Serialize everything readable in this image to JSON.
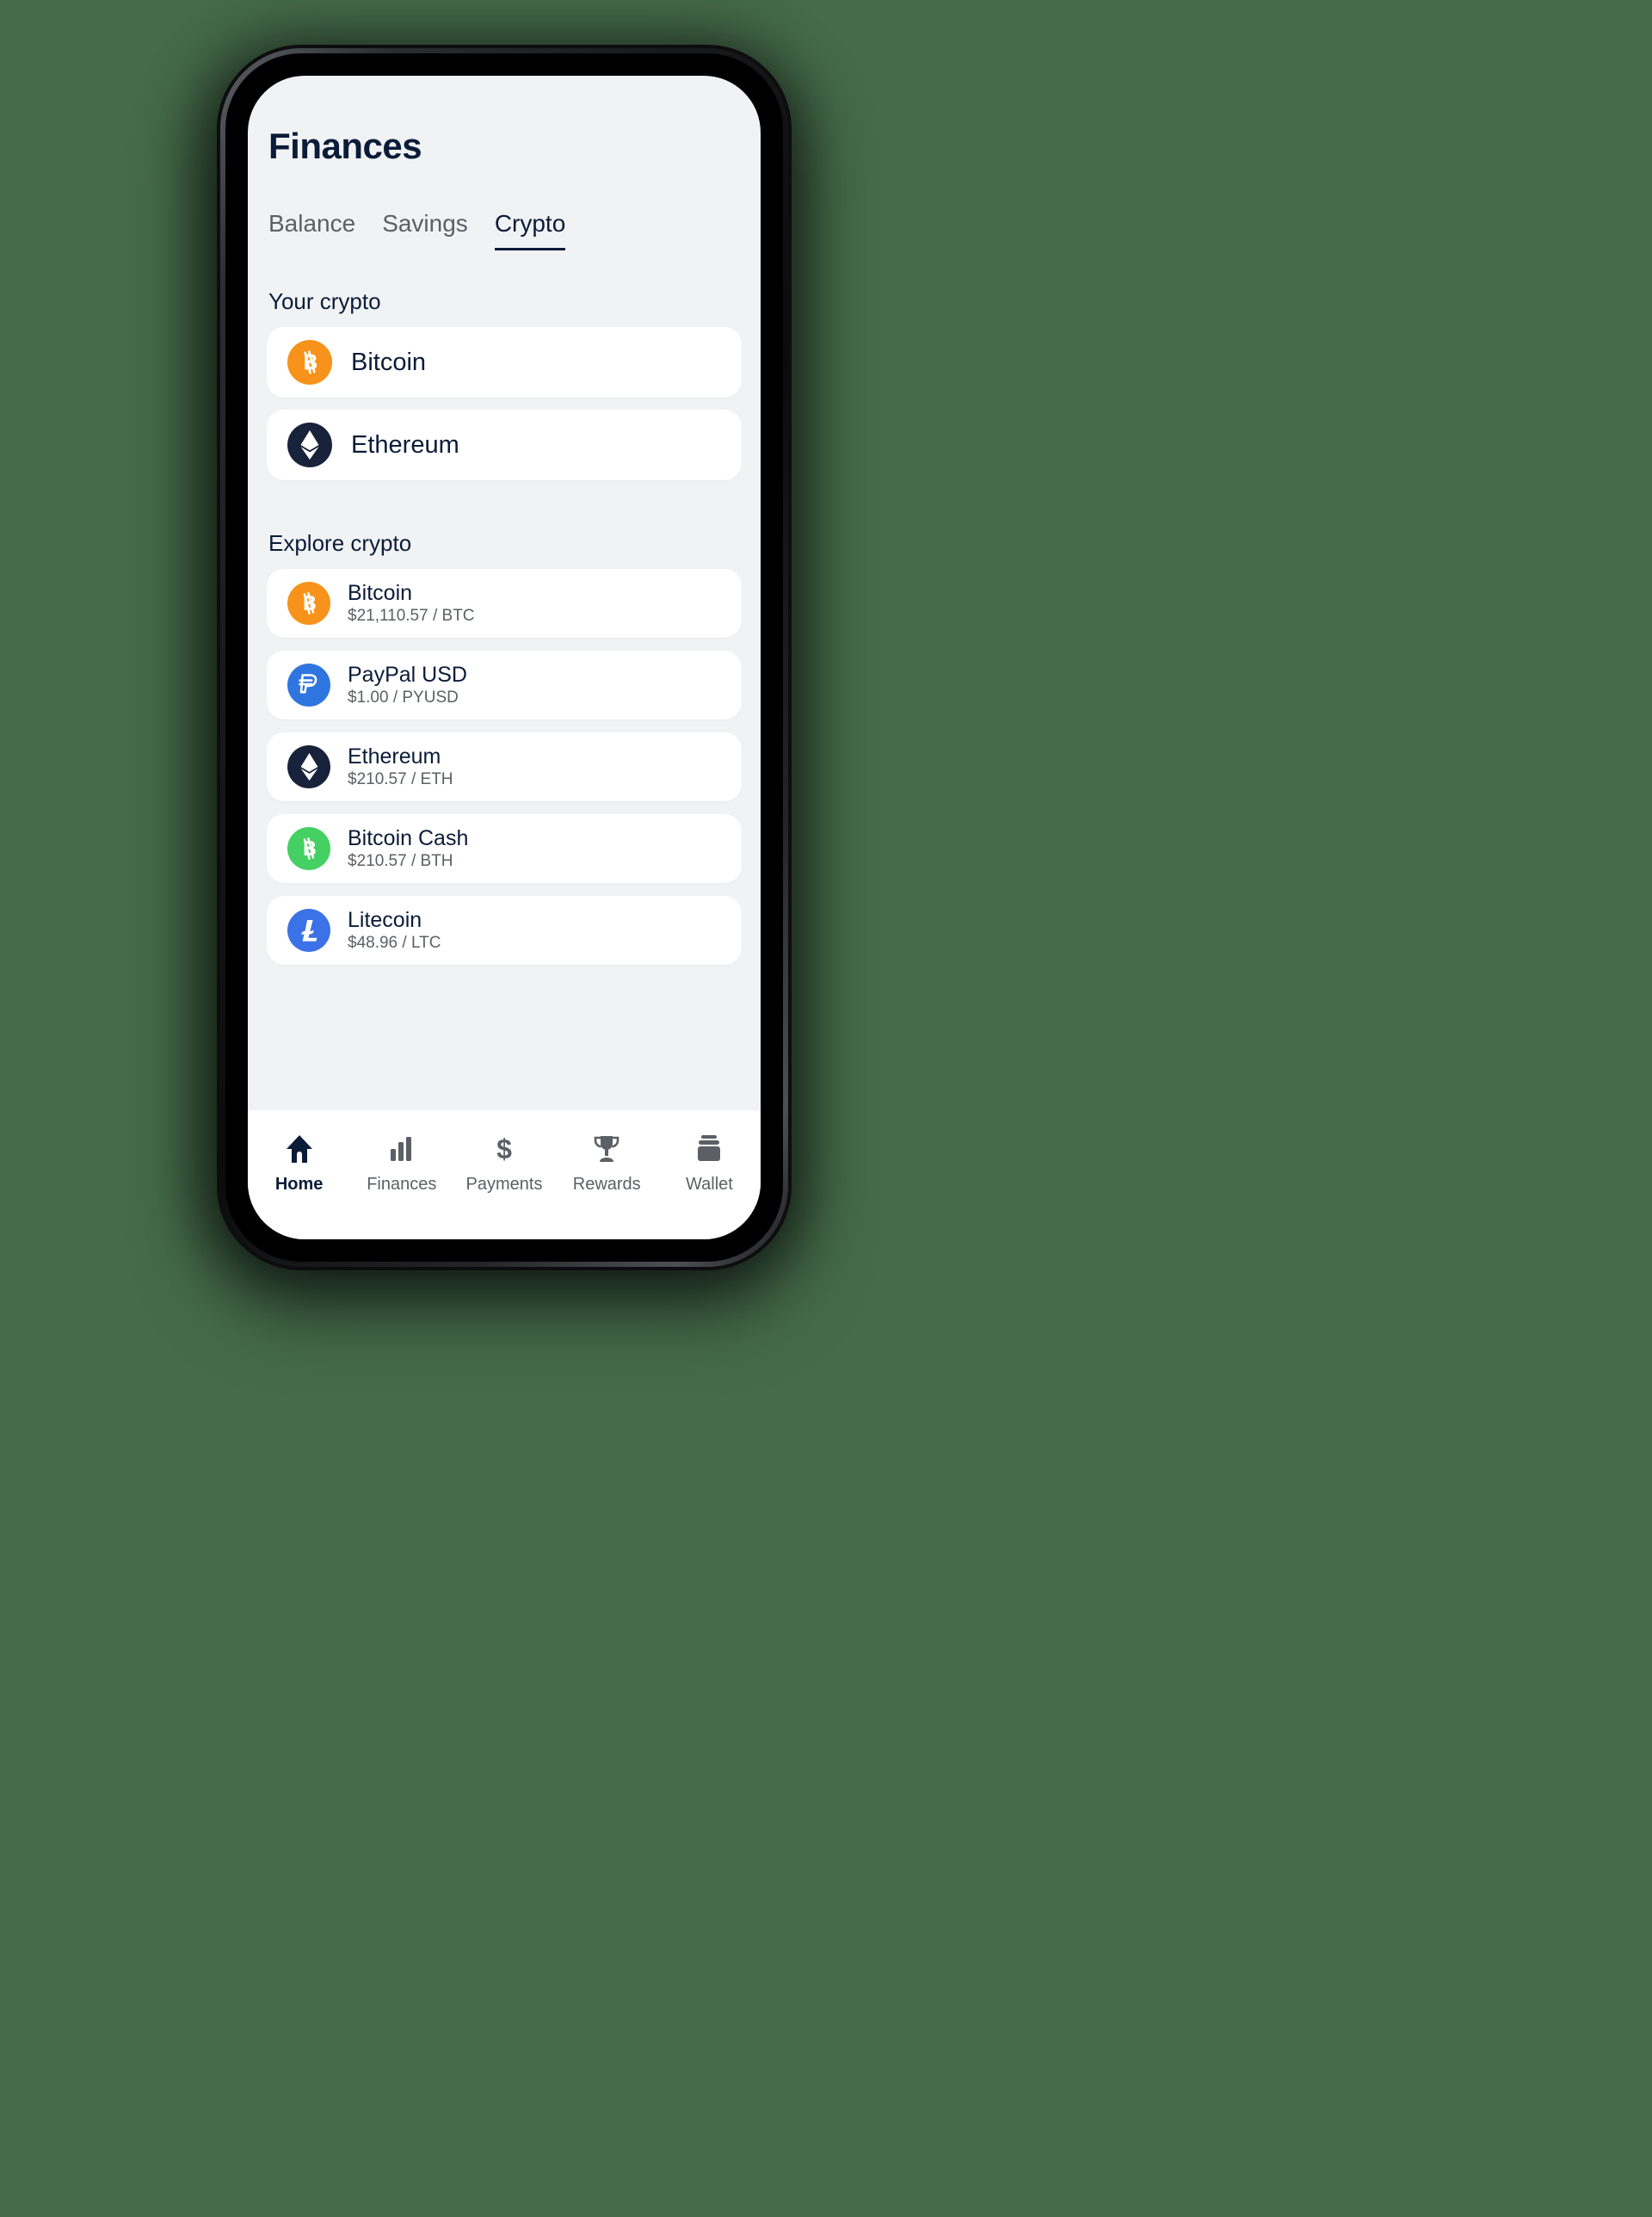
{
  "theme": {
    "background": "#456b4a",
    "screen_bg": "#f1f2f4",
    "card_bg": "#ffffff",
    "text_primary": "#0b1c38",
    "text_secondary": "#5c6066"
  },
  "header": {
    "title": "Finances"
  },
  "tabs": [
    {
      "label": "Balance",
      "active": false
    },
    {
      "label": "Savings",
      "active": false
    },
    {
      "label": "Crypto",
      "active": true
    }
  ],
  "your_crypto": {
    "section_label": "Your crypto",
    "items": [
      {
        "name": "Bitcoin",
        "icon": "bitcoin-icon",
        "color": "#f7931a"
      },
      {
        "name": "Ethereum",
        "icon": "ethereum-icon",
        "color": "#18223a"
      }
    ]
  },
  "explore_crypto": {
    "section_label": "Explore crypto",
    "items": [
      {
        "name": "Bitcoin",
        "price": "$21,110.57 / BTC",
        "icon": "bitcoin-icon",
        "color": "#f7931a"
      },
      {
        "name": "PayPal USD",
        "price": "$1.00 / PYUSD",
        "icon": "paypal-icon",
        "color": "#2f75e0"
      },
      {
        "name": "Ethereum",
        "price": "$210.57 / ETH",
        "icon": "ethereum-icon",
        "color": "#18223a"
      },
      {
        "name": "Bitcoin Cash",
        "price": "$210.57 / BTH",
        "icon": "bitcoincash-icon",
        "color": "#44d062"
      },
      {
        "name": "Litecoin",
        "price": "$48.96 / LTC",
        "icon": "litecoin-icon",
        "color": "#3b72e8"
      }
    ]
  },
  "bottom_nav": [
    {
      "label": "Home",
      "icon": "home-icon",
      "active": true
    },
    {
      "label": "Finances",
      "icon": "barchart-icon",
      "active": false
    },
    {
      "label": "Payments",
      "icon": "dollar-icon",
      "active": false
    },
    {
      "label": "Rewards",
      "icon": "trophy-icon",
      "active": false
    },
    {
      "label": "Wallet",
      "icon": "wallet-icon",
      "active": false
    }
  ]
}
